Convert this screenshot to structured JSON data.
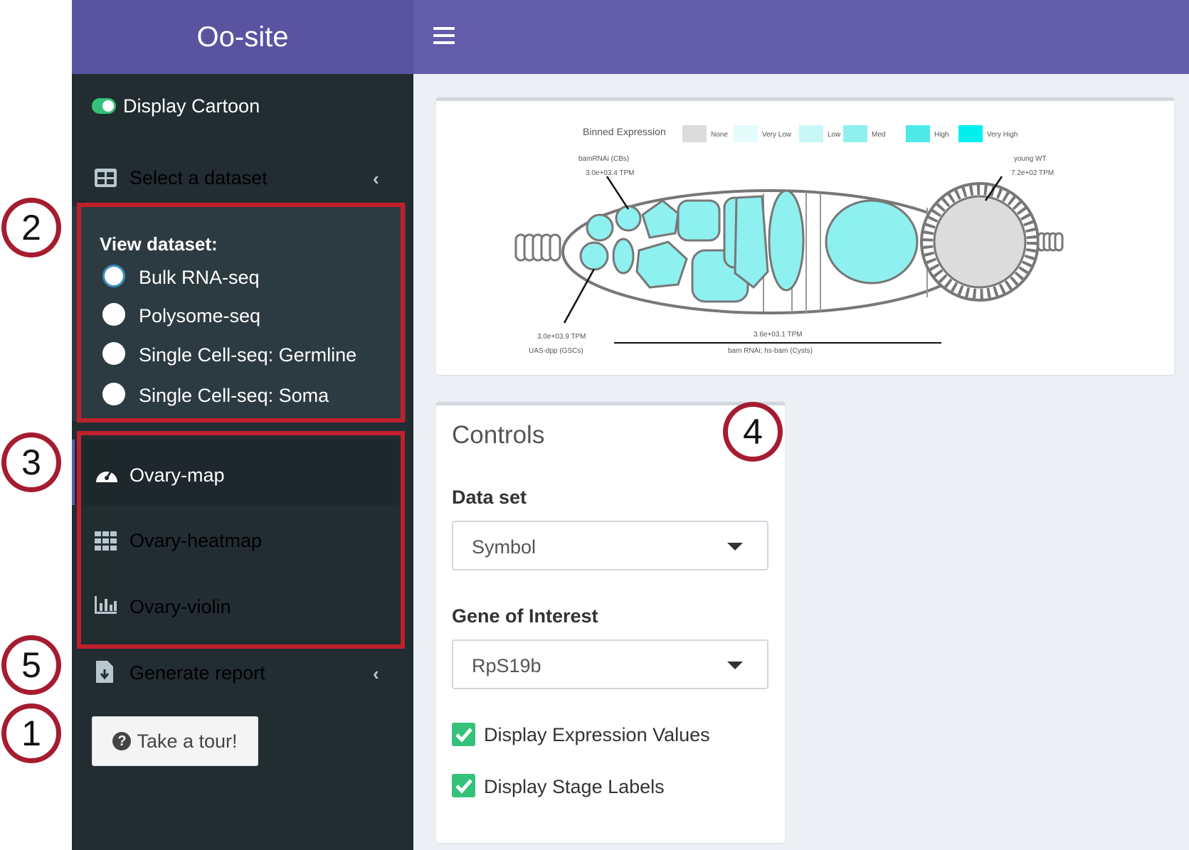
{
  "header": {
    "app_title": "Oo-site"
  },
  "sidebar": {
    "display_cartoon_label": "Display Cartoon",
    "select_dataset_label": "Select a dataset",
    "view_dataset_heading": "View dataset:",
    "dataset_options": [
      "Bulk RNA-seq",
      "Polysome-seq",
      "Single Cell-seq: Germline",
      "Single Cell-seq: Soma"
    ],
    "selected_dataset": "Bulk RNA-seq",
    "nav": [
      {
        "label": "Ovary-map",
        "icon": "dashboard-icon"
      },
      {
        "label": "Ovary-heatmap",
        "icon": "grid-icon"
      },
      {
        "label": "Ovary-violin",
        "icon": "bar-chart-icon"
      }
    ],
    "generate_report_label": "Generate report",
    "tour_button_label": "Take a tour!"
  },
  "annotations": [
    "2",
    "3",
    "5",
    "1",
    "4"
  ],
  "cartoon": {
    "legend_title": "Binned Expression",
    "legend_items": [
      {
        "label": "None",
        "color": "#dcdcdc"
      },
      {
        "label": "Very Low",
        "color": "#e6fbfb"
      },
      {
        "label": "Low",
        "color": "#c8f7f7"
      },
      {
        "label": "Med",
        "color": "#8ff0f0"
      },
      {
        "label": "High",
        "color": "#4fe9e9"
      },
      {
        "label": "Very High",
        "color": "#00f0f0"
      }
    ],
    "labels": {
      "top_left_stage": "bamRNAi (CBs)",
      "top_left_value": "3.0e+03.4 TPM",
      "top_right_stage": "young WT",
      "top_right_value": "7.2e+02 TPM",
      "bottom_left_value": "3.0e+03.9 TPM",
      "bottom_left_stage": "UAS-dpp (GSCs)",
      "bottom_mid_value": "3.6e+03.1 TPM",
      "bottom_mid_stage": "bam RNAi; hs-bam (Cysts)"
    }
  },
  "controls": {
    "title": "Controls",
    "dataset_label": "Data set",
    "dataset_value": "Symbol",
    "gene_label": "Gene of Interest",
    "gene_value": "RpS19b",
    "checkboxes": [
      {
        "label": "Display Expression Values",
        "checked": true
      },
      {
        "label": "Display Stage Labels",
        "checked": true
      }
    ]
  },
  "colors": {
    "header": "#625cab",
    "sidebar": "#222d32",
    "accent": "#3c8dbc",
    "annotation": "#c0202c",
    "check": "#34c27a"
  }
}
